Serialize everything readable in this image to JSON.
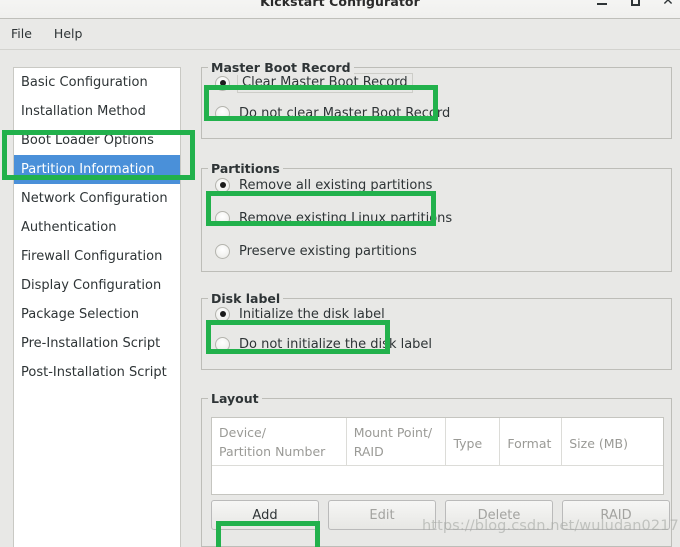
{
  "window": {
    "title": "Kickstart Configurator",
    "controls": [
      {
        "name": "minimize-button",
        "label": "–"
      },
      {
        "name": "maximize-button",
        "label": "□"
      },
      {
        "name": "close-button",
        "label": "×"
      }
    ]
  },
  "menubar": {
    "items": [
      {
        "label": "File"
      },
      {
        "label": "Help"
      }
    ]
  },
  "sidebar": {
    "items": [
      {
        "label": "Basic Configuration",
        "selected": false
      },
      {
        "label": "Installation Method",
        "selected": false
      },
      {
        "label": "Boot Loader Options",
        "selected": false
      },
      {
        "label": "Partition Information",
        "selected": true
      },
      {
        "label": "Network Configuration",
        "selected": false
      },
      {
        "label": "Authentication",
        "selected": false
      },
      {
        "label": "Firewall Configuration",
        "selected": false
      },
      {
        "label": "Display Configuration",
        "selected": false
      },
      {
        "label": "Package Selection",
        "selected": false
      },
      {
        "label": "Pre-Installation Script",
        "selected": false
      },
      {
        "label": "Post-Installation Script",
        "selected": false
      }
    ]
  },
  "groups": {
    "mbr": {
      "title": "Master Boot Record",
      "options": [
        {
          "label": "Clear Master Boot Record",
          "selected": true,
          "focused": true
        },
        {
          "label": "Do not clear Master Boot Record",
          "selected": false,
          "focused": false
        }
      ]
    },
    "partitions": {
      "title": "Partitions",
      "options": [
        {
          "label": "Remove all existing partitions",
          "selected": true,
          "focused": false
        },
        {
          "label": "Remove existing Linux partitions",
          "selected": false,
          "focused": false
        },
        {
          "label": "Preserve existing partitions",
          "selected": false,
          "focused": false
        }
      ]
    },
    "disk_label": {
      "title": "Disk label",
      "options": [
        {
          "label": "Initialize the disk label",
          "selected": true,
          "focused": false
        },
        {
          "label": "Do not initialize the disk label",
          "selected": false,
          "focused": false
        }
      ]
    },
    "layout": {
      "title": "Layout",
      "columns": [
        "Device/\nPartition Number",
        "Mount Point/\nRAID",
        "Type",
        "Format",
        "Size (MB)"
      ],
      "rows": [],
      "buttons": [
        {
          "label": "Add",
          "enabled": true
        },
        {
          "label": "Edit",
          "enabled": false
        },
        {
          "label": "Delete",
          "enabled": false
        },
        {
          "label": "RAID",
          "enabled": false
        }
      ]
    }
  },
  "annotations": {
    "highlight_color": "#22b14c",
    "selection_color": "#4a90d9",
    "boxes": [
      "sidebar-partition-information",
      "clear-master-boot-record",
      "remove-all-existing-partitions",
      "initialize-the-disk-label",
      "add-button"
    ]
  },
  "watermark": {
    "text": "https://blog.csdn.net/wuludan0217"
  }
}
